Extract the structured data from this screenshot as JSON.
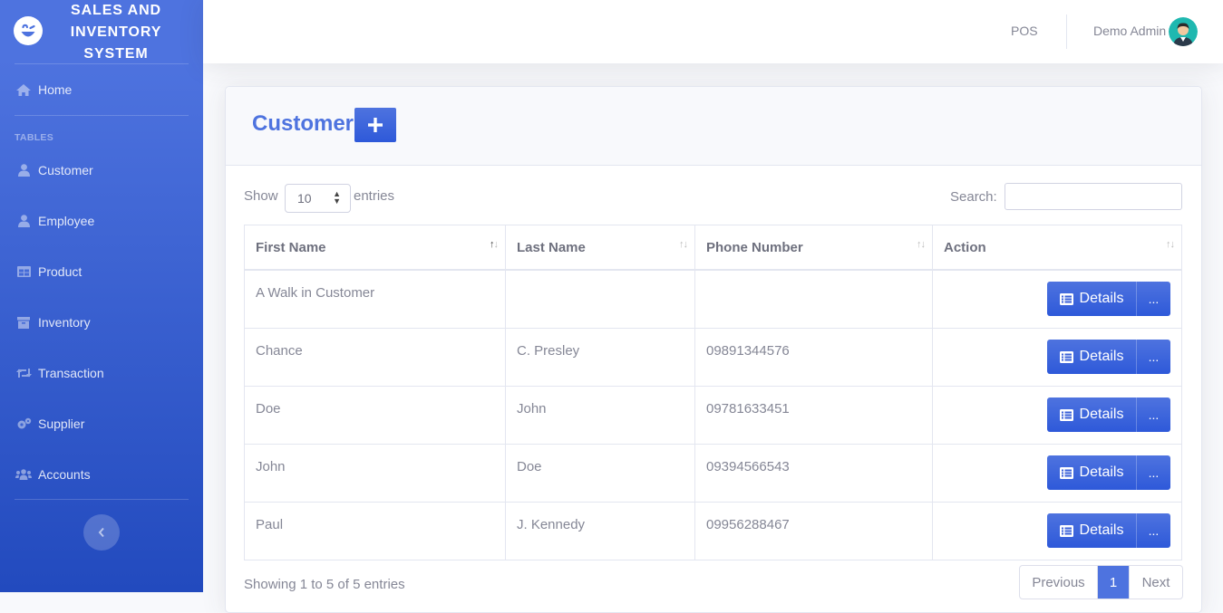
{
  "brand": {
    "title": "SALES AND INVENTORY SYSTEM"
  },
  "sidebar": {
    "home": "Home",
    "heading": "TABLES",
    "items": [
      {
        "label": "Customer",
        "icon": "user-icon"
      },
      {
        "label": "Employee",
        "icon": "user-icon"
      },
      {
        "label": "Product",
        "icon": "table-icon"
      },
      {
        "label": "Inventory",
        "icon": "archive-icon"
      },
      {
        "label": "Transaction",
        "icon": "retweet-icon"
      },
      {
        "label": "Supplier",
        "icon": "cogs-icon"
      },
      {
        "label": "Accounts",
        "icon": "users-icon"
      }
    ]
  },
  "topbar": {
    "pos": "POS",
    "user": "Demo Admin"
  },
  "page": {
    "title": "Customer"
  },
  "controls": {
    "show": "Show",
    "entries_value": "10",
    "entries": "entries",
    "search_label": "Search:"
  },
  "table": {
    "headers": [
      "First Name",
      "Last Name",
      "Phone Number",
      "Action"
    ],
    "rows": [
      {
        "first": "A Walk in Customer",
        "last": "",
        "phone": ""
      },
      {
        "first": "Chance",
        "last": "C. Presley",
        "phone": "09891344576"
      },
      {
        "first": "Doe",
        "last": "John",
        "phone": "09781633451"
      },
      {
        "first": "John",
        "last": "Doe",
        "phone": "09394566543"
      },
      {
        "first": "Paul",
        "last": "J. Kennedy",
        "phone": "09956288467"
      }
    ],
    "details_label": "Details",
    "more_label": "..."
  },
  "footer": {
    "info": "Showing 1 to 5 of 5 entries",
    "previous": "Previous",
    "page": "1",
    "next": "Next"
  },
  "colors": {
    "primary": "#4e73df",
    "primary_dark": "#224abe",
    "text": "#858796"
  }
}
